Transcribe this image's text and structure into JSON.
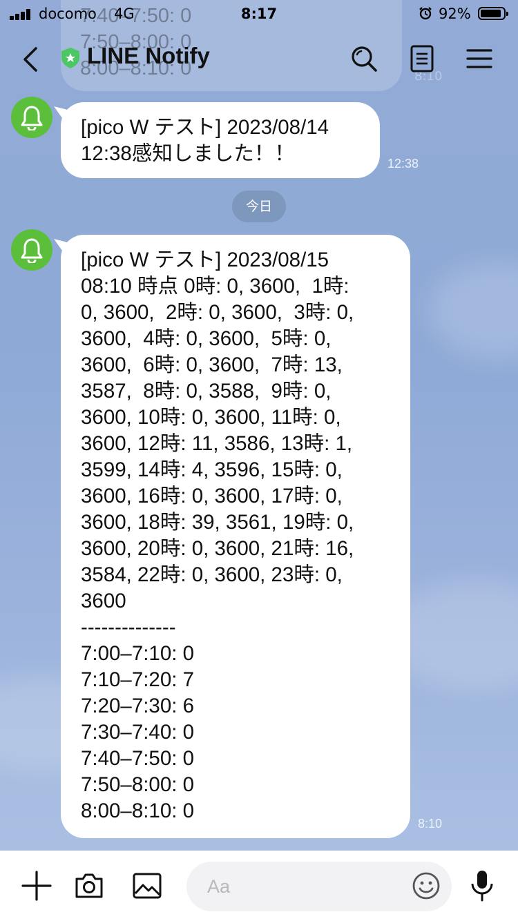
{
  "status_bar": {
    "carrier": "docomo",
    "network": "4G",
    "time": "8:17",
    "battery_percent": "92%",
    "battery_level": 0.92
  },
  "header": {
    "title": "LINE Notify",
    "icons": [
      "back-icon",
      "shield-icon",
      "search-icon",
      "note-icon",
      "menu-icon"
    ]
  },
  "previous_message_fragment": {
    "text": "7:40–7:50: 0\n7:50–8:00: 0\n8:00–8:10: 0",
    "time": "8:10"
  },
  "messages": [
    {
      "text": "[pico W テスト] 2023/08/14\n12:38感知しました！！",
      "time": "12:38"
    },
    {
      "text": "[pico W テスト] 2023/08/15\n08:10 時点 0時: 0, 3600,  1時:\n0, 3600,  2時: 0, 3600,  3時: 0,\n3600,  4時: 0, 3600,  5時: 0,\n3600,  6時: 0, 3600,  7時: 13,\n3587,  8時: 0, 3588,  9時: 0,\n3600, 10時: 0, 3600, 11時: 0,\n3600, 12時: 11, 3586, 13時: 1,\n3599, 14時: 4, 3596, 15時: 0,\n3600, 16時: 0, 3600, 17時: 0,\n3600, 18時: 39, 3561, 19時: 0,\n3600, 20時: 0, 3600, 21時: 16,\n3584, 22時: 0, 3600, 23時: 0,\n3600\n--------------\n7:00–7:10: 0\n7:10–7:20: 7\n7:20–7:30: 6\n7:30–7:40: 0\n7:40–7:50: 0\n7:50–8:00: 0\n8:00–8:10: 0",
      "time": "8:10"
    }
  ],
  "date_separator": "今日",
  "input_bar": {
    "placeholder": "Aa",
    "icons": [
      "plus-icon",
      "camera-icon",
      "image-icon",
      "emoji-icon",
      "microphone-icon"
    ]
  }
}
